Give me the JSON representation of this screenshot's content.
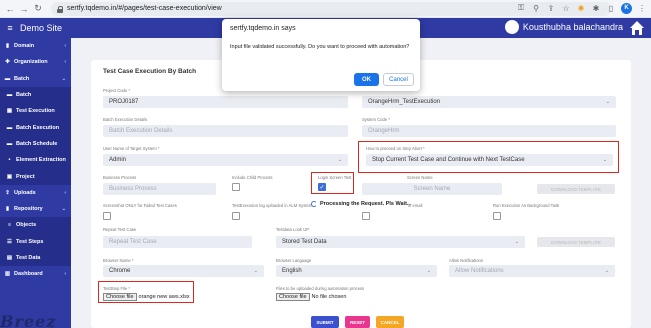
{
  "browser": {
    "url": "sertfy.tqdemo.in/#/pages/test-case-execution/view",
    "profile_initial": "K"
  },
  "app": {
    "brand": "Demo Site",
    "user_name": "Kousthubha balachandra"
  },
  "sidebar": {
    "items": [
      {
        "label": "Domain",
        "icon": "domain-icon",
        "arrow": "‹"
      },
      {
        "label": "Organization",
        "icon": "organization-icon",
        "arrow": "‹"
      },
      {
        "label": "Batch",
        "icon": "folder-icon",
        "arrow": "⌄"
      },
      {
        "label": "Batch",
        "icon": "folder-icon",
        "arrow": ""
      },
      {
        "label": "Test Execution",
        "icon": "grid-icon",
        "arrow": ""
      },
      {
        "label": "Batch Execution",
        "icon": "folder-icon",
        "arrow": ""
      },
      {
        "label": "Batch Schedule",
        "icon": "folder-icon",
        "arrow": ""
      },
      {
        "label": "Element Extraction",
        "icon": "dot-icon",
        "arrow": ""
      },
      {
        "label": "Project",
        "icon": "project-icon",
        "arrow": ""
      },
      {
        "label": "Uploads",
        "icon": "upload-icon",
        "arrow": "‹"
      },
      {
        "label": "Repository",
        "icon": "repository-icon",
        "arrow": "⌄"
      },
      {
        "label": "Objects",
        "icon": "objects-icon",
        "arrow": ""
      },
      {
        "label": "Test Steps",
        "icon": "list-icon",
        "arrow": ""
      },
      {
        "label": "Test Data",
        "icon": "table-icon",
        "arrow": ""
      },
      {
        "label": "Dashboard",
        "icon": "chart-icon",
        "arrow": "‹"
      }
    ]
  },
  "form": {
    "title": "Test Case Execution By Batch",
    "project_code_label": "Project Code *",
    "project_code_value": "PROJ0187",
    "right_top_value": "OrangeHrm_TestExecution",
    "batch_exec_details_label": "Batch Execution Details",
    "batch_exec_details_placeholder": "Batch Execution Details",
    "system_code_label": "System Code *",
    "system_code_value": "OrangeHrm",
    "user_name_label": "User Name of Target System *",
    "user_name_value": "Admin",
    "proceed_label": "How to proceed on Step Abort *",
    "proceed_value": "Stop Current Test Case and Continue with Next TestCase",
    "business_process_label": "Business Process",
    "business_process_placeholder": "Business Process",
    "include_child_label": "Include Child Process",
    "login_screen_label": "Login Screen Test",
    "screen_name_label": "Screen Name",
    "screen_name_placeholder": "Screen Name",
    "download_template_1": "DOWNLOAD TEMPLATE",
    "screenshot_label": "Screenshot ONLY for Failed Test Cases",
    "test_exec_log_label": "TestExecution log uploaded in ALM System",
    "email_label": "in email",
    "run_background_label": "Run Execution As Background Task",
    "processing_text": "Processing the Request. Pls Wait...",
    "repeat_test_label": "Repeat Test Case",
    "repeat_test_placeholder": "Repeat Test Case",
    "testdata_lookup_label": "Testdata Look UP",
    "testdata_lookup_value": "Stored Test Data",
    "download_template_2": "DOWNLOAD TEMPLATE",
    "browser_name_label": "Browser Name *",
    "browser_name_value": "Chrome",
    "browser_language_label": "Browser Language",
    "browser_language_value": "English",
    "allow_notifications_label": "Allow Notifications",
    "allow_notifications_placeholder": "Allow Notifications",
    "test_step_file_label": "TestStep File *",
    "choose_file_label": "Choose file",
    "test_step_file_value": "orange new aws.xlsx",
    "upload_during_label": "Files to be uploaded during automation process",
    "no_file_chosen": "No file chosen",
    "submit": "SUBMIT",
    "reset": "RESET",
    "cancel": "CANCEL"
  },
  "dialog": {
    "title": "sertfy.tqdemo.in says",
    "message": "Input file validated successfully. Do you want to proceed with automation?",
    "ok": "OK",
    "cancel": "Cancel"
  },
  "overlay_logo": "Breez"
}
